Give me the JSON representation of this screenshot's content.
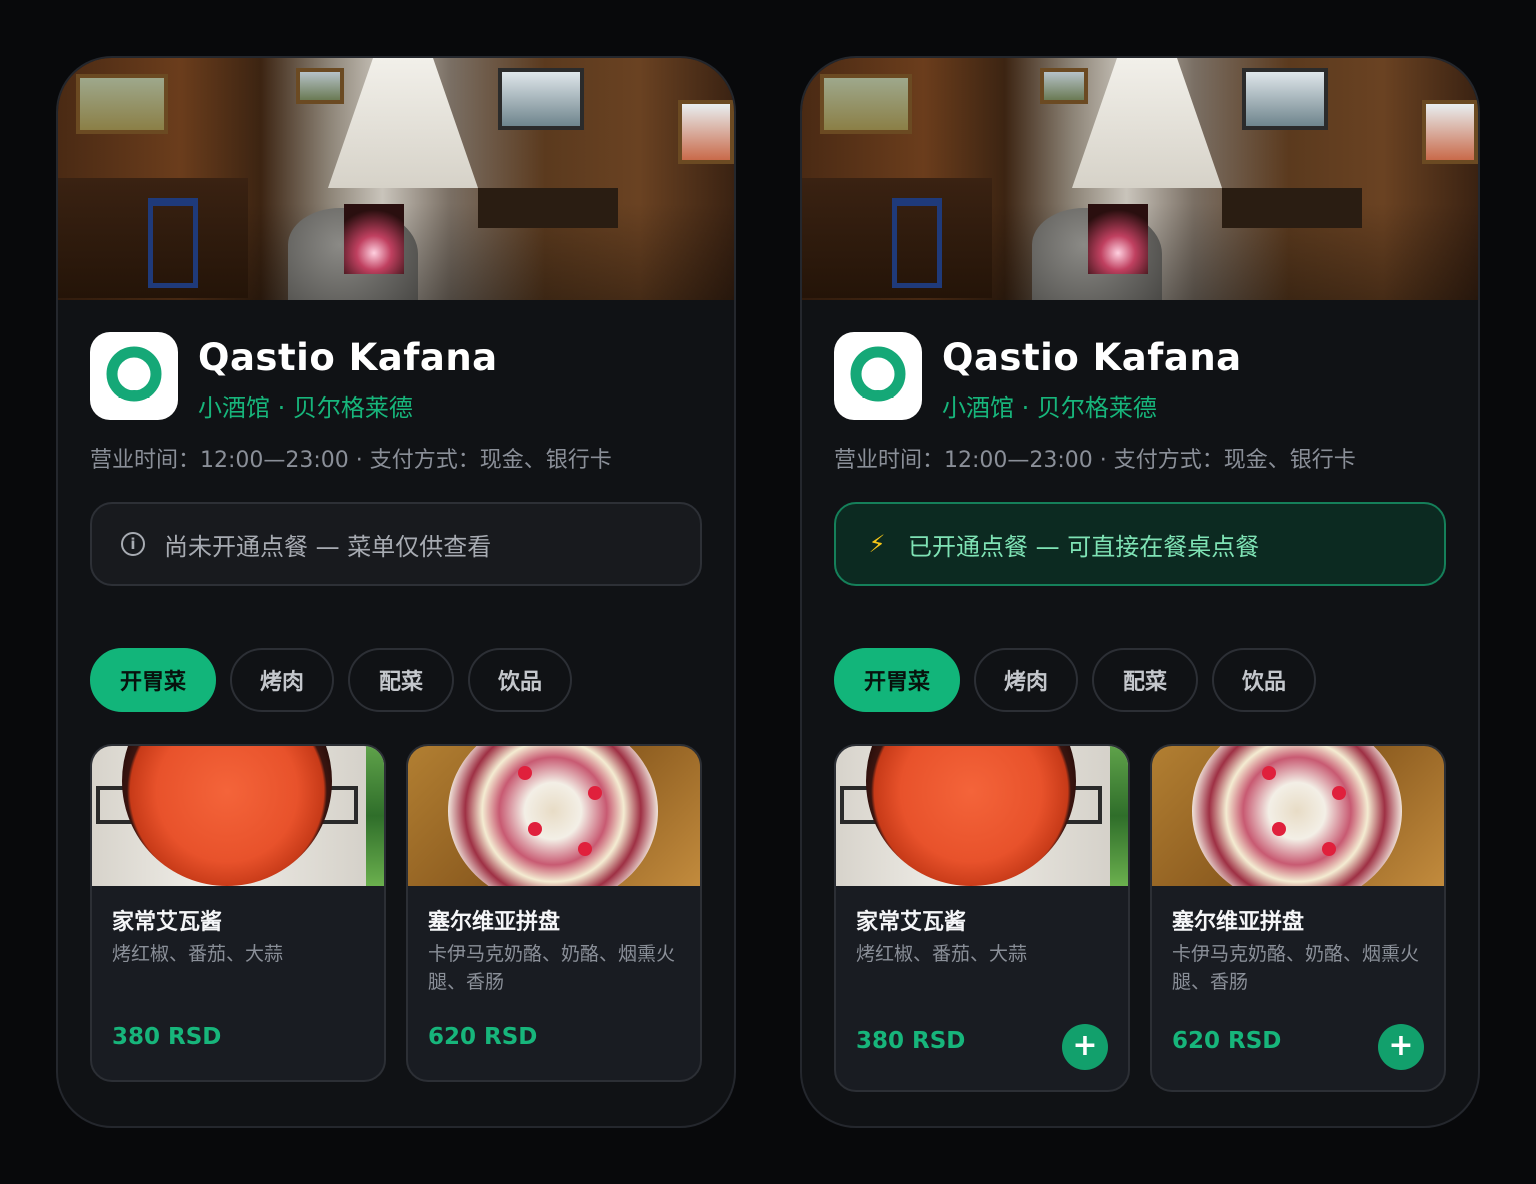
{
  "colors": {
    "accent": "#12b57a",
    "background": "#08090b",
    "card": "#101215"
  },
  "cards": [
    {
      "variant": "ordering-disabled",
      "restaurant": {
        "name": "Qastio Kafana",
        "subtitle": "小酒馆 · 贝尔格莱德",
        "meta": "营业时间：12:00—23:00 · 支付方式：现金、银行卡"
      },
      "banner": {
        "icon": "info-circle-icon",
        "text": "尚未开通点餐 — 菜单仅供查看",
        "glyph": "i"
      },
      "tabs": [
        {
          "label": "开胃菜",
          "active": true
        },
        {
          "label": "烤肉",
          "active": false
        },
        {
          "label": "配菜",
          "active": false
        },
        {
          "label": "饮品",
          "active": false
        }
      ],
      "items": [
        {
          "name": "家常艾瓦酱",
          "desc": "烤红椒、番茄、大蒜",
          "price": "380 RSD",
          "photo": "ajvar-photo"
        },
        {
          "name": "塞尔维亚拼盘",
          "desc": "卡伊马克奶酪、奶酪、烟熏火腿、香肠",
          "price": "620 RSD",
          "photo": "platter-photo"
        }
      ]
    },
    {
      "variant": "ordering-enabled",
      "restaurant": {
        "name": "Qastio Kafana",
        "subtitle": "小酒馆 · 贝尔格莱德",
        "meta": "营业时间：12:00—23:00 · 支付方式：现金、银行卡"
      },
      "banner": {
        "icon": "lightning-icon",
        "text": "已开通点餐 — 可直接在餐桌点餐",
        "glyph": "⚡"
      },
      "tabs": [
        {
          "label": "开胃菜",
          "active": true
        },
        {
          "label": "烤肉",
          "active": false
        },
        {
          "label": "配菜",
          "active": false
        },
        {
          "label": "饮品",
          "active": false
        }
      ],
      "items": [
        {
          "name": "家常艾瓦酱",
          "desc": "烤红椒、番茄、大蒜",
          "price": "380 RSD",
          "photo": "ajvar-photo",
          "add": "+"
        },
        {
          "name": "塞尔维亚拼盘",
          "desc": "卡伊马克奶酪、奶酪、烟熏火腿、香肠",
          "price": "620 RSD",
          "photo": "platter-photo",
          "add": "+"
        }
      ]
    }
  ]
}
